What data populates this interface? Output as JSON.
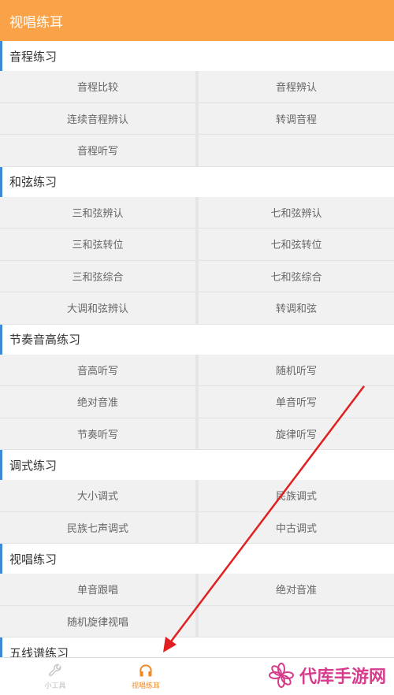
{
  "header": {
    "title": "视唱练耳"
  },
  "sections": [
    {
      "title": "音程练习",
      "items": [
        "音程比较",
        "音程辨认",
        "连续音程辨认",
        "转调音程",
        "音程听写",
        ""
      ]
    },
    {
      "title": "和弦练习",
      "items": [
        "三和弦辨认",
        "七和弦辨认",
        "三和弦转位",
        "七和弦转位",
        "三和弦综合",
        "七和弦综合",
        "大调和弦辨认",
        "转调和弦"
      ]
    },
    {
      "title": "节奏音高练习",
      "items": [
        "音高听写",
        "随机听写",
        "绝对音准",
        "单音听写",
        "节奏听写",
        "旋律听写"
      ]
    },
    {
      "title": "调式练习",
      "items": [
        "大小调式",
        "民族调式",
        "民族七声调式",
        "中古调式"
      ]
    },
    {
      "title": "视唱练习",
      "items": [
        "单音跟唱",
        "绝对音准",
        "随机旋律视唱",
        ""
      ]
    },
    {
      "title": "五线谱练习",
      "items": []
    }
  ],
  "tabbar": {
    "tabs": [
      {
        "label": "小工具",
        "icon": "wrench-icon",
        "active": false
      },
      {
        "label": "视唱练耳",
        "icon": "headphones-icon",
        "active": true
      }
    ]
  },
  "watermark": {
    "text": "代库手游网",
    "color": "#d63c8c"
  },
  "colors": {
    "header": "#f9a247",
    "accent": "#3d8bd8",
    "active_tab": "#f08a24",
    "arrow": "#e02020"
  }
}
